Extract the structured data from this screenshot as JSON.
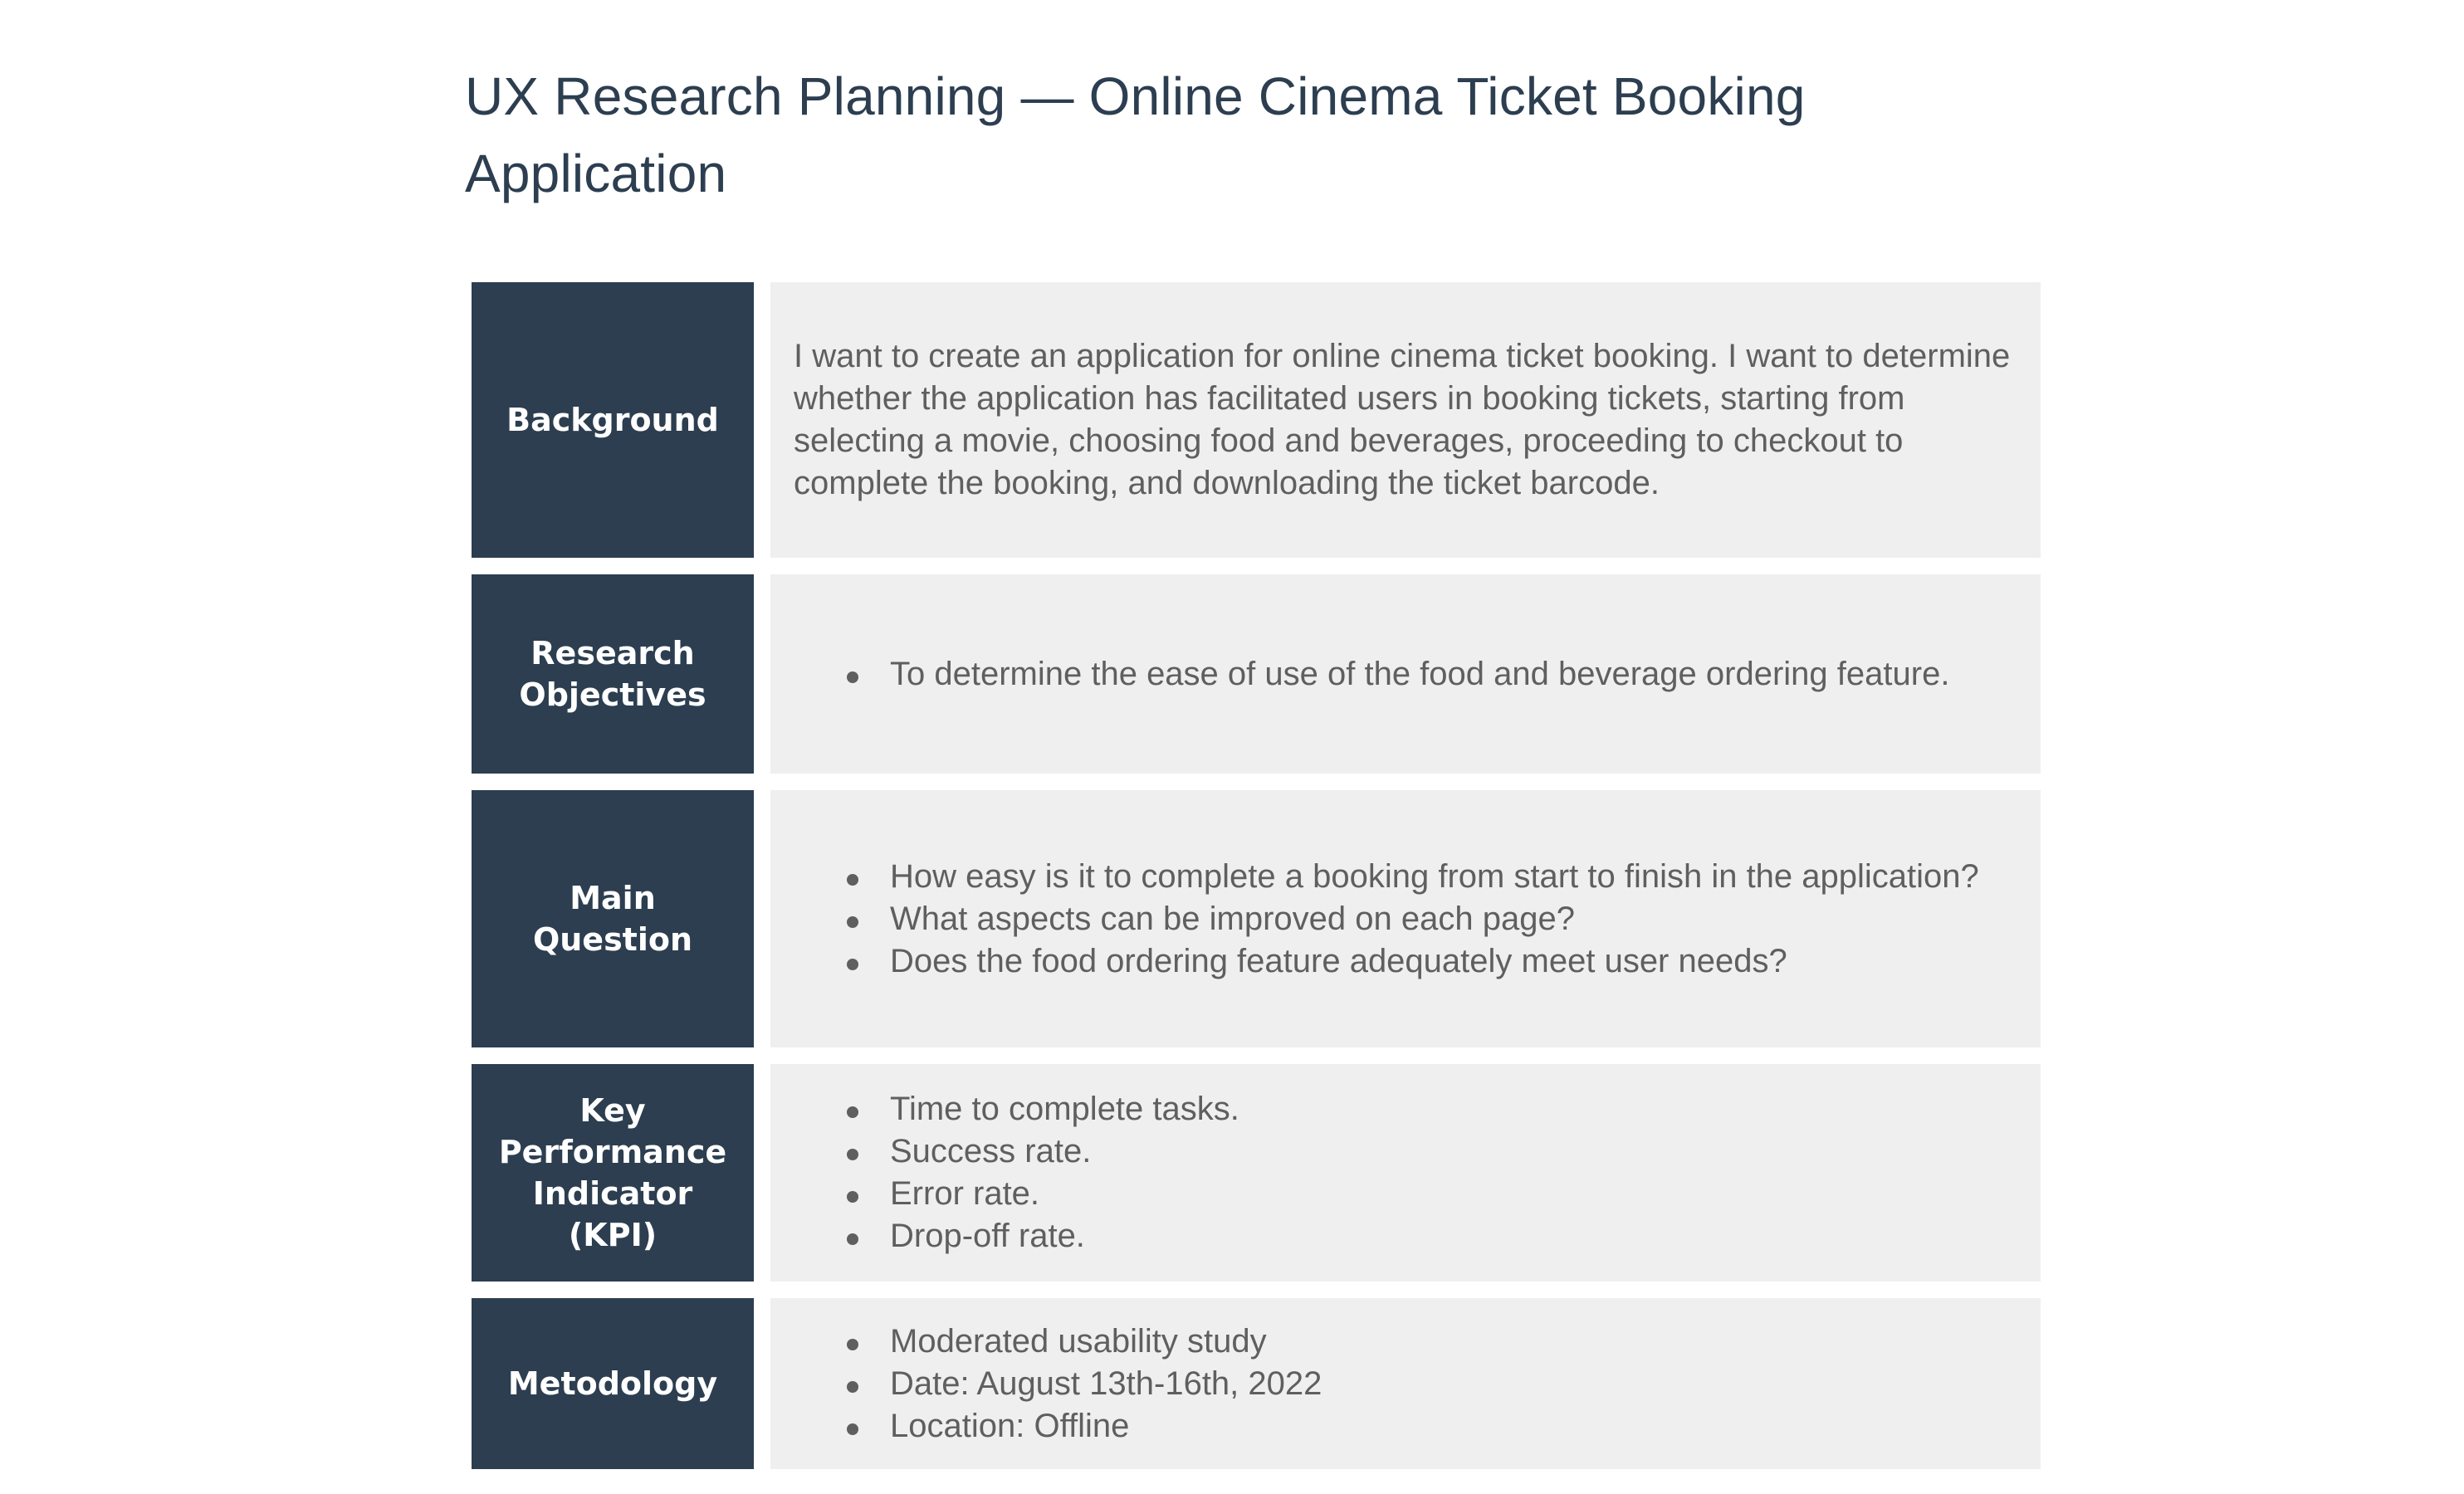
{
  "document": {
    "title": "UX Research Planning — Online Cinema Ticket Booking Application"
  },
  "plan": {
    "background": {
      "label": "Background",
      "text": "I want to create an application for online cinema ticket booking. I want to determine whether the application has facilitated users in booking tickets, starting from selecting a movie, choosing food and beverages, proceeding to checkout to complete the booking, and downloading the ticket barcode."
    },
    "objectives": {
      "label": "Research Objectives",
      "items": [
        "To determine the ease of use of the food and beverage ordering feature."
      ]
    },
    "main_question": {
      "label": "Main Question",
      "items": [
        "How easy is it to complete a booking from start to finish in the application?",
        "What aspects can be improved on each page?",
        "Does the food ordering feature adequately meet user needs?"
      ]
    },
    "kpi": {
      "label": "Key Performance Indicator (KPI)",
      "items": [
        "Time to complete tasks.",
        "Success rate.",
        "Error rate.",
        "Drop-off rate."
      ]
    },
    "methodology": {
      "label": "Metodology",
      "items": [
        "Moderated usability study",
        "Date: August 13th-16th, 2022",
        "Location: Offline"
      ]
    }
  },
  "colors": {
    "label_background": "#2c3e50",
    "content_background": "#efefef",
    "title_text": "#2c3e50",
    "body_text": "#5f5f5f"
  }
}
